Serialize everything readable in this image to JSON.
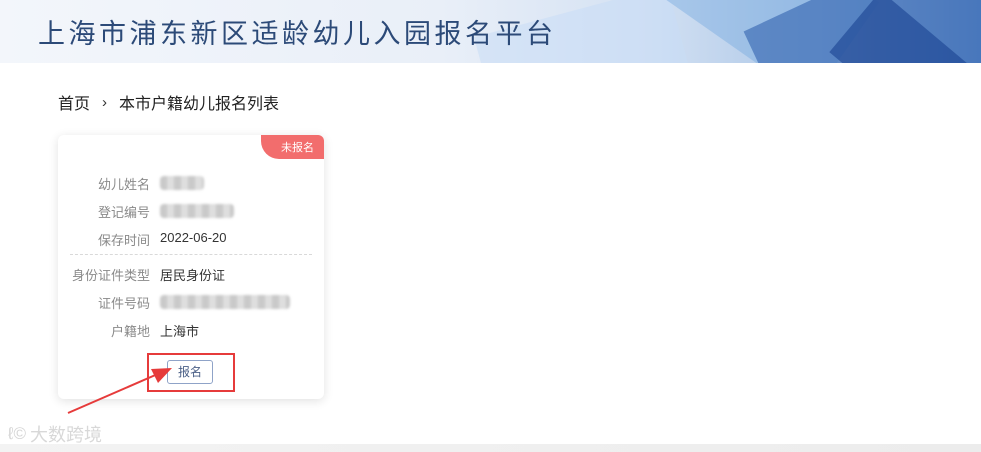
{
  "header": {
    "title": "上海市浦东新区适龄幼儿入园报名平台"
  },
  "breadcrumb": {
    "home": "首页",
    "separator": "›",
    "current": "本市户籍幼儿报名列表"
  },
  "card": {
    "status_badge": "未报名",
    "fields": {
      "child_name_label": "幼儿姓名",
      "reg_no_label": "登记编号",
      "save_time_label": "保存时间",
      "save_time_value": "2022-06-20",
      "id_type_label": "身份证件类型",
      "id_type_value": "居民身份证",
      "id_no_label": "证件号码",
      "household_label": "户籍地",
      "household_value": "上海市"
    },
    "signup_button": "报名"
  },
  "watermark": {
    "text": "大数跨境"
  },
  "colors": {
    "badge": "#f26d6d",
    "annotation_red": "#e63b3b",
    "title": "#2c4a78"
  }
}
